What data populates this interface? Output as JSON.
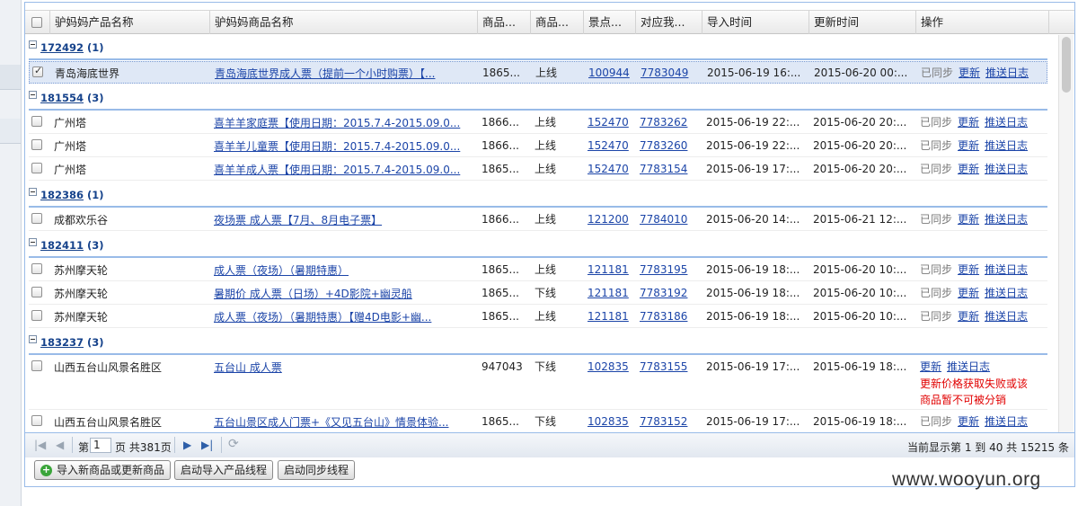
{
  "columns": [
    "驴妈妈产品名称",
    "驴妈妈商品名称",
    "商品...",
    "商品...",
    "景点...",
    "对应我...",
    "导入时间",
    "更新时间",
    "操作"
  ],
  "groups": [
    {
      "id": "172492",
      "count": "(1)",
      "rows": [
        {
          "product": "青岛海底世界",
          "goods": "青岛海底世界成人票（提前一个小时购票）【...",
          "gid": "1865...",
          "status": "上线",
          "scenic": "100944",
          "mine": "7783049",
          "imported": "2015-06-19 16:...",
          "updated": "2015-06-20 00:...",
          "checked": true,
          "selected": true
        }
      ]
    },
    {
      "id": "181554",
      "count": "(3)",
      "rows": [
        {
          "product": "广州塔",
          "goods": "喜羊羊家庭票【使用日期：2015.7.4-2015.09.0...",
          "gid": "1866...",
          "status": "上线",
          "scenic": "152470",
          "mine": "7783262",
          "imported": "2015-06-19 22:...",
          "updated": "2015-06-20 20:..."
        },
        {
          "product": "广州塔",
          "goods": "喜羊羊儿童票【使用日期：2015.7.4-2015.09.0...",
          "gid": "1866...",
          "status": "上线",
          "scenic": "152470",
          "mine": "7783260",
          "imported": "2015-06-19 22:...",
          "updated": "2015-06-20 20:..."
        },
        {
          "product": "广州塔",
          "goods": "喜羊羊成人票【使用日期：2015.7.4-2015.09.0...",
          "gid": "1865...",
          "status": "上线",
          "scenic": "152470",
          "mine": "7783154",
          "imported": "2015-06-19 17:...",
          "updated": "2015-06-20 20:..."
        }
      ]
    },
    {
      "id": "182386",
      "count": "(1)",
      "rows": [
        {
          "product": "成都欢乐谷",
          "goods": "夜场票 成人票【7月、8月电子票】",
          "gid": "1866...",
          "status": "上线",
          "scenic": "121200",
          "mine": "7784010",
          "imported": "2015-06-20 14:...",
          "updated": "2015-06-21 12:..."
        }
      ]
    },
    {
      "id": "182411",
      "count": "(3)",
      "rows": [
        {
          "product": "苏州摩天轮",
          "goods": "成人票（夜场）（暑期特惠）",
          "gid": "1865...",
          "status": "上线",
          "scenic": "121181",
          "mine": "7783195",
          "imported": "2015-06-19 18:...",
          "updated": "2015-06-20 10:..."
        },
        {
          "product": "苏州摩天轮",
          "goods": "暑期价 成人票（日场）+4D影院+幽灵船",
          "gid": "1865...",
          "status": "下线",
          "scenic": "121181",
          "mine": "7783192",
          "imported": "2015-06-19 18:...",
          "updated": "2015-06-20 10:..."
        },
        {
          "product": "苏州摩天轮",
          "goods": "成人票（夜场）（暑期特惠）【赠4D电影+幽...",
          "gid": "1865...",
          "status": "上线",
          "scenic": "121181",
          "mine": "7783186",
          "imported": "2015-06-19 18:...",
          "updated": "2015-06-20 10:..."
        }
      ]
    },
    {
      "id": "183237",
      "count": "(3)",
      "rows": [
        {
          "product": "山西五台山风景名胜区",
          "goods": "五台山 成人票",
          "gid": "947043",
          "status": "下线",
          "scenic": "102835",
          "mine": "7783155",
          "imported": "2015-06-19 17:...",
          "updated": "2015-06-19 18:...",
          "error": "更新价格获取失败或该商品暂不可被分销",
          "error_line1": "更新价格获取失败或该",
          "error_line2": "商品暂不可被分销"
        },
        {
          "product": "山西五台山风景名胜区",
          "goods": "五台山景区成人门票+《又见五台山》情景体验...",
          "gid": "1865...",
          "status": "下线",
          "scenic": "102835",
          "mine": "7783152",
          "imported": "2015-06-19 17:...",
          "updated": "2015-06-19 18:..."
        }
      ]
    }
  ],
  "ops": {
    "synced": "已同步",
    "update": "更新",
    "push_log": "推送日志"
  },
  "pager": {
    "prefix": "第",
    "page": "1",
    "suffix": "页 共381页",
    "summary": "当前显示第 1 到 40 共 15215 条"
  },
  "buttons": {
    "import": "导入新商品或更新商品",
    "start_import": "启动导入产品线程",
    "start_sync": "启动同步线程"
  },
  "watermark": "www.wooyun.org",
  "colors": {
    "link": "#1c45a8",
    "group": "#15428b",
    "error": "#e10000",
    "border": "#99bbe8"
  }
}
